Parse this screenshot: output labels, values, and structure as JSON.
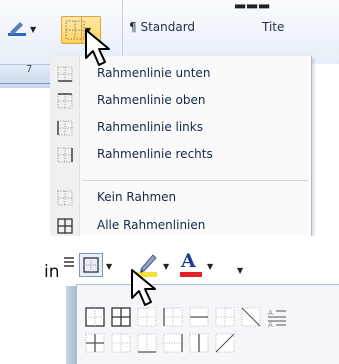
{
  "ribbon": {
    "styles": [
      {
        "label": "¶ Standard"
      },
      {
        "label": "Tite"
      }
    ]
  },
  "ruler": {
    "number": "7"
  },
  "border_menu": {
    "items": [
      {
        "label": "Rahmenlinie unten"
      },
      {
        "label": "Rahmenlinie oben"
      },
      {
        "label": "Rahmenlinie links"
      },
      {
        "label": "Rahmenlinie rechts"
      },
      {
        "label": "Kein Rahmen"
      },
      {
        "label": "Alle Rahmenlinien"
      }
    ]
  },
  "bottom": {
    "label_in": "in",
    "font_color_letter": "A"
  },
  "colors": {
    "accent_orange": "#ffd35e",
    "font_color_red": "#e0202a",
    "menu_text": "#14284a"
  }
}
